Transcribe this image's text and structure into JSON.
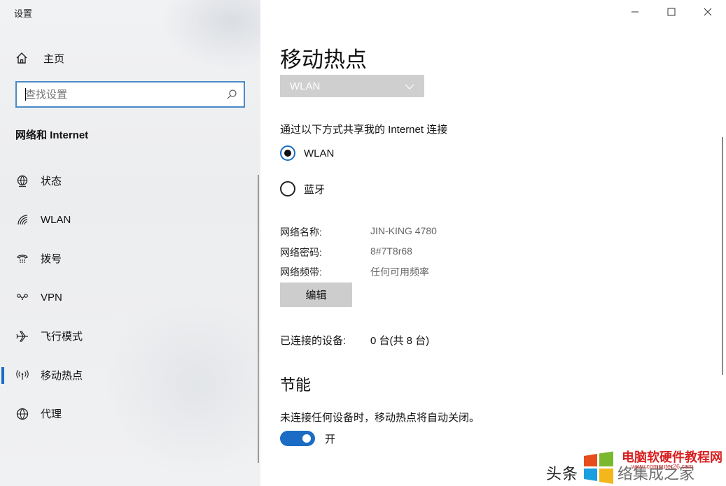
{
  "window": {
    "title": "设置"
  },
  "sidebar": {
    "home_label": "主页",
    "search_placeholder": "查找设置",
    "section_title": "网络和 Internet",
    "items": [
      {
        "label": "状态",
        "icon": "globe-status-icon"
      },
      {
        "label": "WLAN",
        "icon": "wifi-icon"
      },
      {
        "label": "拨号",
        "icon": "dialup-icon"
      },
      {
        "label": "VPN",
        "icon": "vpn-icon"
      },
      {
        "label": "飞行模式",
        "icon": "airplane-icon"
      },
      {
        "label": "移动热点",
        "icon": "hotspot-icon",
        "active": true
      },
      {
        "label": "代理",
        "icon": "globe-icon"
      }
    ]
  },
  "main": {
    "title": "移动热点",
    "dropdown_value": "WLAN",
    "share_label": "通过以下方式共享我的 Internet 连接",
    "radio_options": [
      {
        "label": "WLAN",
        "selected": true
      },
      {
        "label": "蓝牙",
        "selected": false
      }
    ],
    "info": {
      "name_key": "网络名称:",
      "name_value": "JIN-KING 4780",
      "password_key": "网络密码:",
      "password_value": "8#7T8r68",
      "band_key": "网络频带:",
      "band_value": "任何可用频率"
    },
    "edit_button": "编辑",
    "connected_key": "已连接的设备:",
    "connected_value": "0 台(共 8 台)",
    "power_saving_heading": "节能",
    "power_saving_desc": "未连接任何设备时，移动热点将自动关闭。",
    "toggle_label": "开",
    "toggle_on": true
  },
  "watermark": {
    "left_text": "头条",
    "brand": "电脑软硬件教程网",
    "url": "www.computer26.com",
    "right_text": "络集成之家"
  },
  "colors": {
    "accent": "#1a6cc4",
    "sidebar_bg": "#eff0f2",
    "button_bg": "#cdcdcd",
    "dropdown_bg": "#cfcfcf"
  }
}
